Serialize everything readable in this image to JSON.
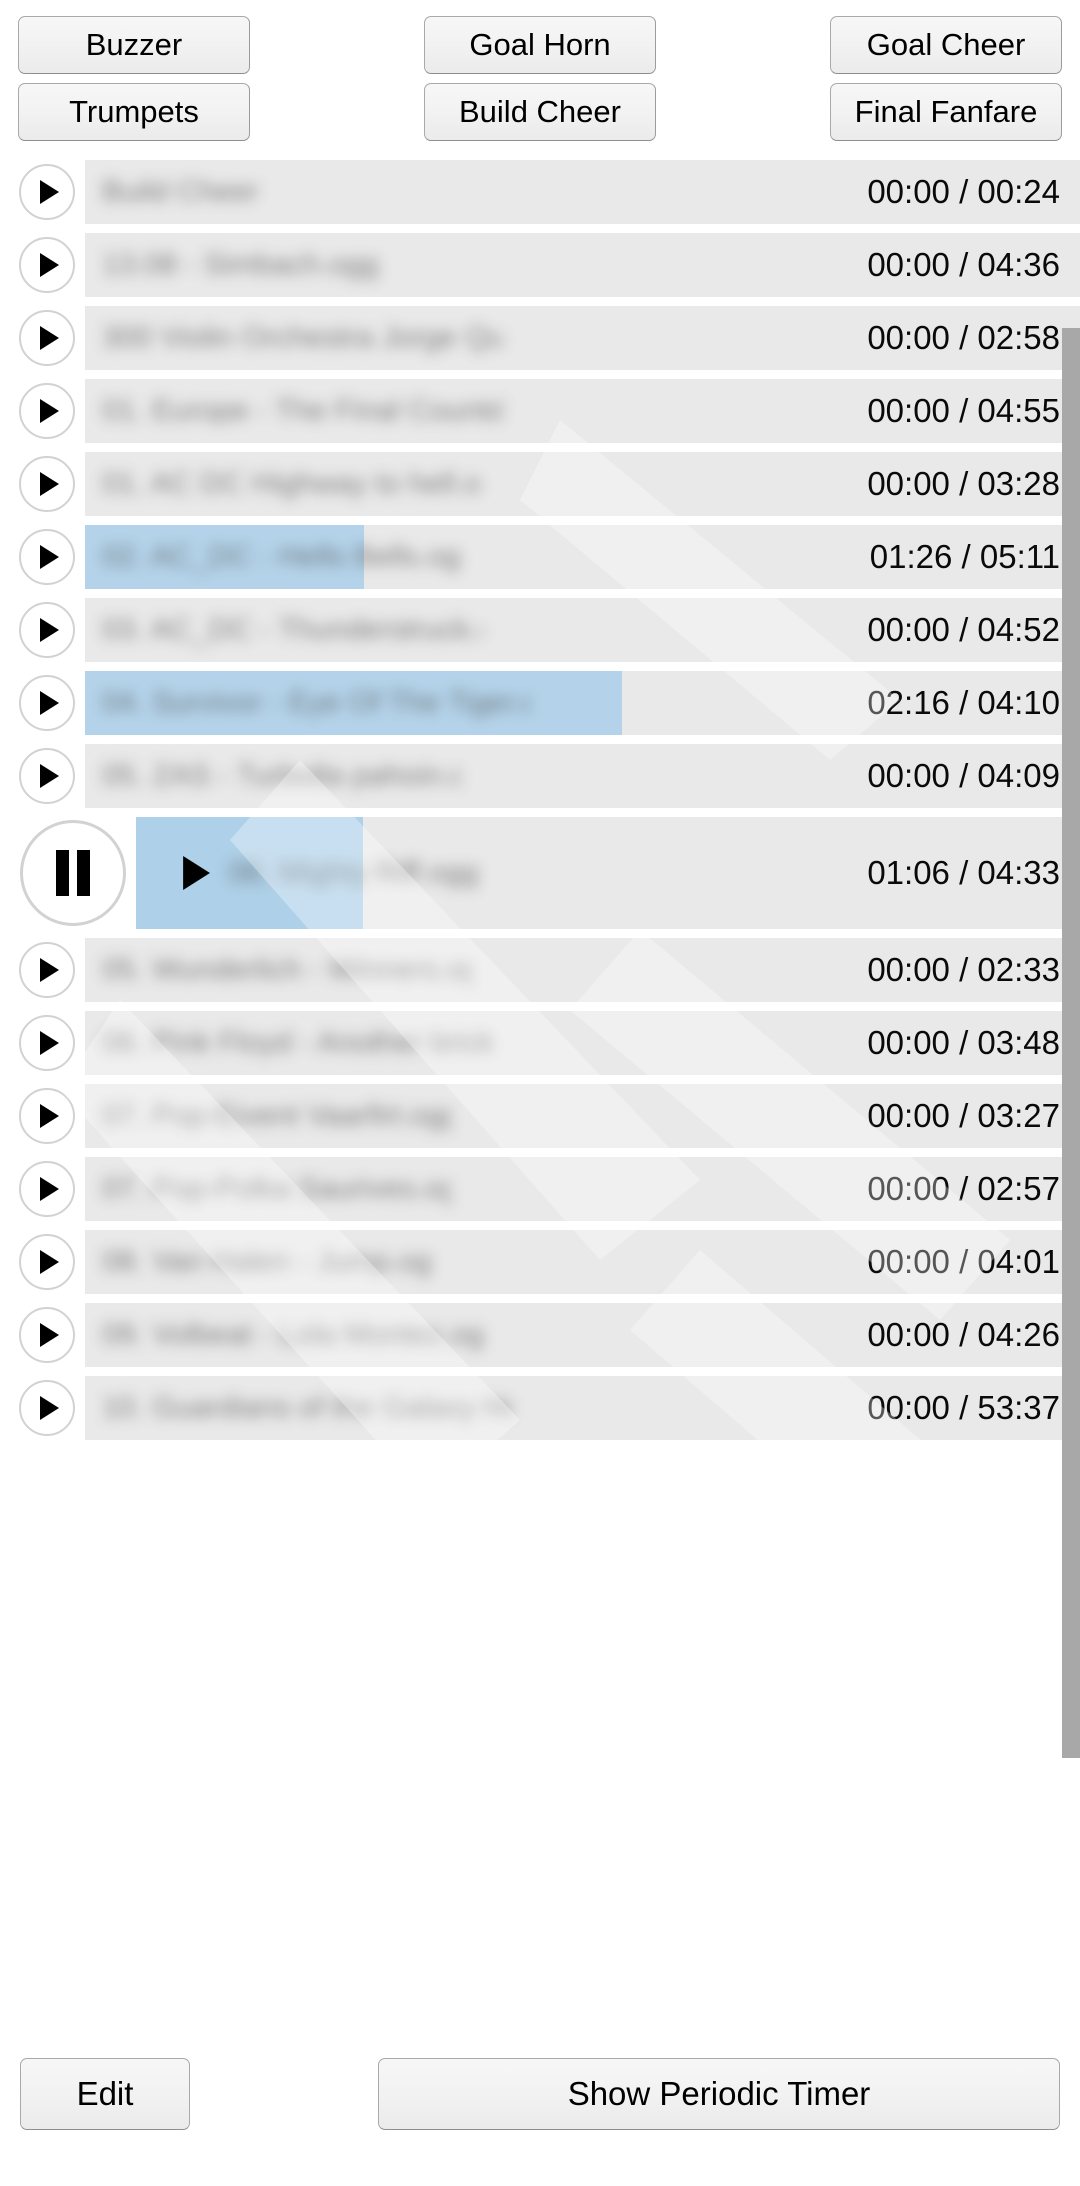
{
  "soundpad": {
    "rows": [
      [
        {
          "label": "Buzzer",
          "name": "sound-button-buzzer"
        },
        {
          "label": "Goal Horn",
          "name": "sound-button-goal-horn"
        },
        {
          "label": "Goal Cheer",
          "name": "sound-button-goal-cheer"
        }
      ],
      [
        {
          "label": "Trumpets",
          "name": "sound-button-trumpets"
        },
        {
          "label": "Build Cheer",
          "name": "sound-button-build-cheer"
        },
        {
          "label": "Final Fanfare",
          "name": "sound-button-final-fanfare"
        }
      ]
    ]
  },
  "colors": {
    "row_background": "#e9e9e9",
    "progress_fill": "#b4d3ea",
    "scrollbar_thumb": "#a8a8a8",
    "button_face": "#f2f2f2",
    "text": "#000000"
  },
  "tracklist": {
    "tracks": [
      {
        "title": "Build Cheer",
        "elapsed": "00:00",
        "duration": "00:24",
        "time": "00:00 / 00:24",
        "progress": 0,
        "state": "stopped",
        "title_width": 200
      },
      {
        "title": "13.08 - Simbach.ogg",
        "elapsed": "00:00",
        "duration": "04:36",
        "time": "00:00 / 04:36",
        "progress": 0,
        "state": "stopped",
        "title_width": 280
      },
      {
        "title": "300 Violin Orchestra Jorge Quint...",
        "elapsed": "00:00",
        "duration": "02:58",
        "time": "00:00 / 02:58",
        "progress": 0,
        "state": "stopped",
        "title_width": 400
      },
      {
        "title": "01. Europe - The Final Countdow...",
        "elapsed": "00:00",
        "duration": "04:55",
        "time": "00:00 / 04:55",
        "progress": 0,
        "state": "stopped",
        "title_width": 400
      },
      {
        "title": "01. AC DC Highway to hell.ogg",
        "elapsed": "00:00",
        "duration": "03:28",
        "time": "00:00 / 03:28",
        "progress": 0,
        "state": "stopped",
        "title_width": 380
      },
      {
        "title": "02. AC_DC - Hells Bells.ogg",
        "elapsed": "01:26",
        "duration": "05:11",
        "time": "01:26 / 05:11",
        "progress": 28,
        "state": "paused",
        "title_width": 360
      },
      {
        "title": "03. AC_DC - Thunderstruck.ogg",
        "elapsed": "00:00",
        "duration": "04:52",
        "time": "00:00 / 04:52",
        "progress": 0,
        "state": "stopped",
        "title_width": 380
      },
      {
        "title": "04. Survivor - Eye Of The Tiger.ogg",
        "elapsed": "02:16",
        "duration": "04:10",
        "time": "02:16 / 04:10",
        "progress": 54,
        "state": "paused",
        "title_width": 430
      },
      {
        "title": "05. ZAS - Turbolla pahoin.ogg",
        "elapsed": "00:00",
        "duration": "04:09",
        "time": "00:00 / 04:09",
        "progress": 0,
        "state": "stopped",
        "title_width": 360
      },
      {
        "title": "06. Mighty Riff.ogg",
        "elapsed": "01:06",
        "duration": "04:33",
        "time": "01:06 / 04:33",
        "progress": 24,
        "state": "playing",
        "title_width": 300
      },
      {
        "title": "05. Wunderlich - Winners.ogg",
        "elapsed": "00:00",
        "duration": "02:33",
        "time": "00:00 / 02:33",
        "progress": 0,
        "state": "stopped",
        "title_width": 370
      },
      {
        "title": "06. Pink Floyd - Another brick in t...",
        "elapsed": "00:00",
        "duration": "03:48",
        "time": "00:00 / 03:48",
        "progress": 0,
        "state": "stopped",
        "title_width": 400
      },
      {
        "title": "07. Pop-Eivent Vaarfirt.ogg",
        "elapsed": "00:00",
        "duration": "03:27",
        "time": "00:00 / 03:27",
        "progress": 0,
        "state": "stopped",
        "title_width": 350
      },
      {
        "title": "07. Pop-Polka Saurives.ogg",
        "elapsed": "00:00",
        "duration": "02:57",
        "time": "00:00 / 02:57",
        "progress": 0,
        "state": "stopped",
        "title_width": 350
      },
      {
        "title": "08. Van Halen - Jump.ogg",
        "elapsed": "00:00",
        "duration": "04:01",
        "time": "00:00 / 04:01",
        "progress": 0,
        "state": "stopped",
        "title_width": 330
      },
      {
        "title": "09. Volbeat - Lola Montez.ogg",
        "elapsed": "00:00",
        "duration": "04:26",
        "time": "00:00 / 04:26",
        "progress": 0,
        "state": "stopped",
        "title_width": 380
      },
      {
        "title": "10. Guardians of the Galaxy Hoo...",
        "elapsed": "00:00",
        "duration": "53:37",
        "time": "00:00 / 53:37",
        "progress": 0,
        "state": "stopped",
        "title_width": 410
      }
    ]
  },
  "bottombar": {
    "edit_label": "Edit",
    "periodic_timer_label": "Show Periodic Timer"
  }
}
